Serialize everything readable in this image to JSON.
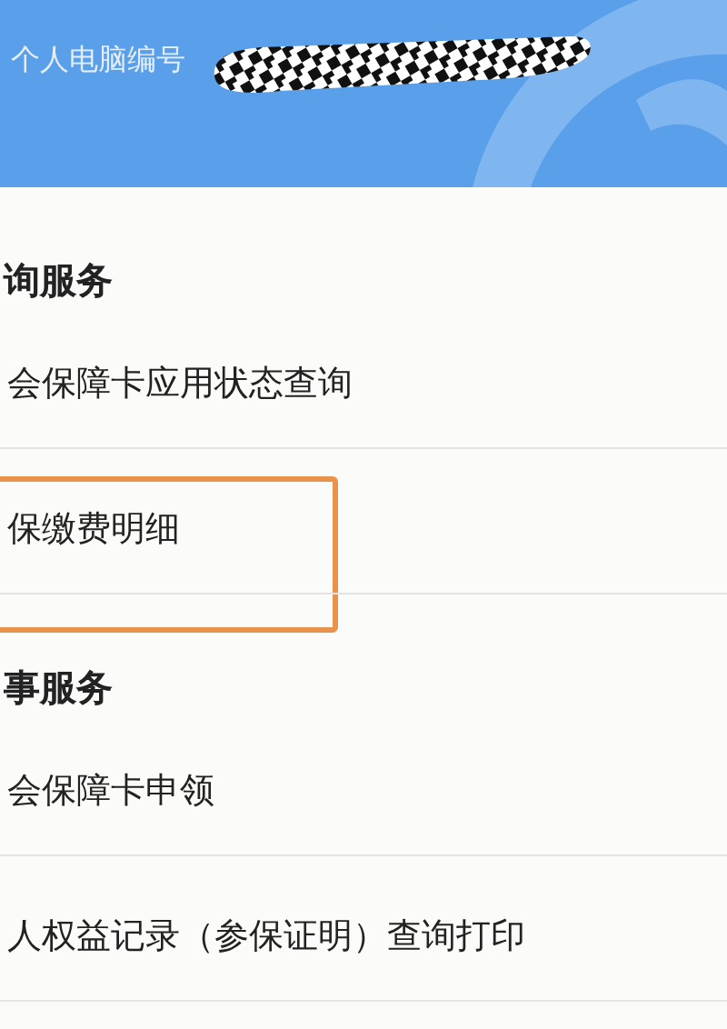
{
  "header": {
    "label": "个人电脑编号",
    "value_redacted": true
  },
  "sections": [
    {
      "title": "询服务",
      "items": [
        {
          "label": "会保障卡应用状态查询",
          "highlighted": false
        },
        {
          "label": "保缴费明细",
          "highlighted": true
        }
      ]
    },
    {
      "title": "事服务",
      "items": [
        {
          "label": "会保障卡申领",
          "highlighted": false
        },
        {
          "label": "人权益记录（参保证明）查询打印",
          "highlighted": false
        }
      ]
    }
  ]
}
